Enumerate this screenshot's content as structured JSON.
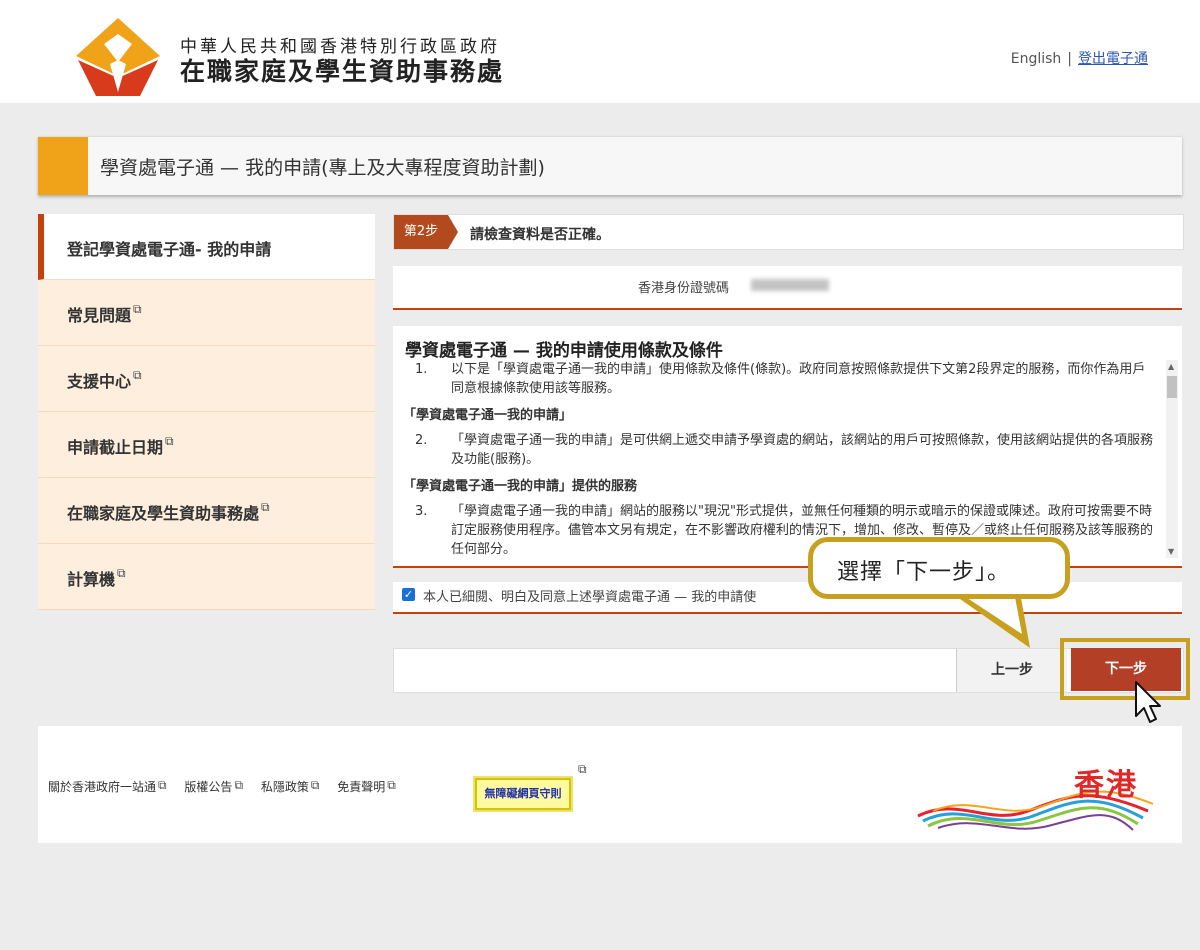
{
  "header": {
    "org_sub": "中華人民共和國香港特別行政區政府",
    "org_main": "在職家庭及學生資助事務處",
    "english_link": "English",
    "separator": "|",
    "logout_link": "登出電子通"
  },
  "banner": {
    "title": "學資處電子通 — 我的申請(專上及大專程度資助計劃)"
  },
  "sidebar": {
    "items": [
      {
        "label": "登記學資處電子通- 我的申請",
        "external": false,
        "active": true
      },
      {
        "label": "常見問題",
        "external": true
      },
      {
        "label": "支援中心",
        "external": true
      },
      {
        "label": "申請截止日期",
        "external": true
      },
      {
        "label": "在職家庭及學生資助事務處",
        "external": true
      },
      {
        "label": "計算機",
        "external": true
      }
    ]
  },
  "step": {
    "badge": "第2步",
    "text": "請檢查資料是否正確。"
  },
  "id_row": {
    "label": "香港身份證號碼"
  },
  "terms": {
    "title": "學資處電子通 — 我的申請使用條款及條件",
    "para1_num": "1.",
    "para1": "以下是「學資處電子通一我的申請」使用條款及條件(條款)。政府同意按照條款提供下文第2段界定的服務，而你作為用戶同意根據條款使用該等服務。",
    "sub1": "「學資處電子通一我的申請」",
    "para2_num": "2.",
    "para2": "「學資處電子通一我的申請」是可供網上遞交申請予學資處的網站，該網站的用戶可按照條款，使用該網站提供的各項服務及功能(服務)。",
    "sub2": "「學資處電子通一我的申請」提供的服務",
    "para3_num": "3.",
    "para3": "「學資處電子通一我的申請」網站的服務以\"現況\"形式提供，並無任何種類的明示或暗示的保證或陳述。政府可按需要不時訂定服務使用程序。儘管本文另有規定，在不影響政府權利的情況下，增加、修改、暫停及／或終止任何服務及該等服務的任何部分。"
  },
  "agree": {
    "checked": true,
    "text": "本人已細閱、明白及同意上述學資處電子通 — 我的申請使"
  },
  "buttons": {
    "prev": "上一步",
    "next": "下一步"
  },
  "callout": {
    "text": "選擇「下一步」。"
  },
  "footer": {
    "links": [
      "關於香港政府一站通",
      "版權公告",
      "私隱政策",
      "免責聲明"
    ],
    "accessibility": "無障礙網頁守則",
    "brand": "香港"
  },
  "colors": {
    "accent_orange": "#f0a219",
    "brand_red": "#c4420e",
    "next_button": "#b33f27",
    "highlight_gold": "#c8a020",
    "sidebar_bg": "#fdeede"
  }
}
